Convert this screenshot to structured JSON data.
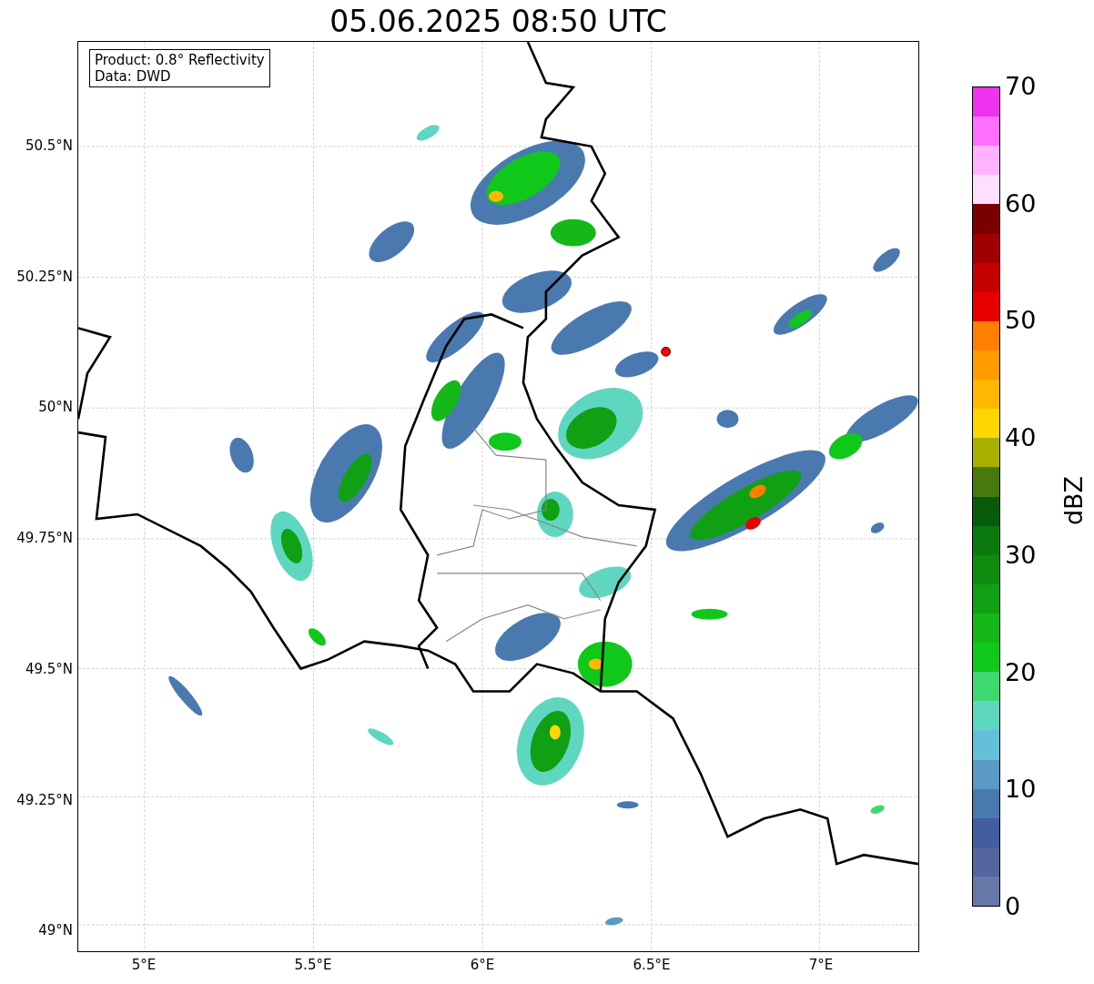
{
  "title": "05.06.2025 08:50 UTC",
  "info_box": [
    "Product: 0.8° Reflectivity",
    "Data: DWD"
  ],
  "y_ticks": [
    "50.5°N",
    "50.25°N",
    "50°N",
    "49.75°N",
    "49.5°N",
    "49.25°N",
    "49°N"
  ],
  "x_ticks": [
    "5°E",
    "5.5°E",
    "6°E",
    "6.5°E",
    "7°E"
  ],
  "colorbar": {
    "label": "dBZ",
    "ticks": [
      "70",
      "60",
      "50",
      "40",
      "30",
      "20",
      "10",
      "0"
    ],
    "bands": [
      {
        "color": "#ee33ee"
      },
      {
        "color": "#ff70ff"
      },
      {
        "color": "#ffb3ff"
      },
      {
        "color": "#ffdfff"
      },
      {
        "color": "#7a0000"
      },
      {
        "color": "#a00000"
      },
      {
        "color": "#c40000"
      },
      {
        "color": "#e60000"
      },
      {
        "color": "#ff7f00"
      },
      {
        "color": "#ff9c00"
      },
      {
        "color": "#ffb800"
      },
      {
        "color": "#ffd700"
      },
      {
        "color": "#a8b000"
      },
      {
        "color": "#467a0c"
      },
      {
        "color": "#085c09"
      },
      {
        "color": "#0b7a0e"
      },
      {
        "color": "#0d8c10"
      },
      {
        "color": "#0fa014"
      },
      {
        "color": "#14b818"
      },
      {
        "color": "#10c81a"
      },
      {
        "color": "#3dd870"
      },
      {
        "color": "#5fd6c0"
      },
      {
        "color": "#64c0d8"
      },
      {
        "color": "#5a9ac4"
      },
      {
        "color": "#4a79b0"
      },
      {
        "color": "#445da0"
      },
      {
        "color": "#53679e"
      },
      {
        "color": "#6677a8"
      }
    ]
  }
}
